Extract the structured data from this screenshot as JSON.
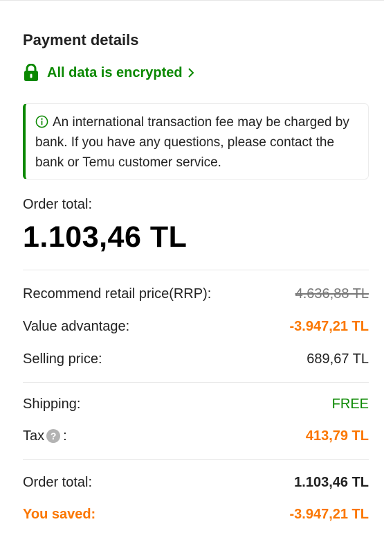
{
  "payment": {
    "title": "Payment details",
    "secure_text": "All data is encrypted",
    "notice": "An international transaction fee may be charged by bank. If you have any questions, please contact the bank or Temu customer service."
  },
  "summary": {
    "order_total_label": "Order total:",
    "order_total_value": "1.103,46 TL",
    "rrp_label": "Recommend retail price(RRP):",
    "rrp_value": "4.636,88 TL",
    "value_adv_label": "Value advantage:",
    "value_adv_value": "-3.947,21 TL",
    "selling_label": "Selling price:",
    "selling_value": "689,67 TL",
    "shipping_label": "Shipping:",
    "shipping_value": "FREE",
    "tax_label": "Tax",
    "tax_help": "?",
    "tax_colon": ":",
    "tax_value": "413,79 TL",
    "final_total_label": "Order total:",
    "final_total_value": "1.103,46 TL",
    "saved_label": "You saved:",
    "saved_value": "-3.947,21 TL"
  },
  "colors": {
    "secure_green": "#0a8800",
    "discount_orange": "#fb7701",
    "divider": "#e5e5e5"
  },
  "icons": {
    "secure": "lock-icon",
    "secure_arrow": "chevron-right-icon",
    "notice": "info-circle-icon",
    "tax_help": "question-circle-icon"
  }
}
